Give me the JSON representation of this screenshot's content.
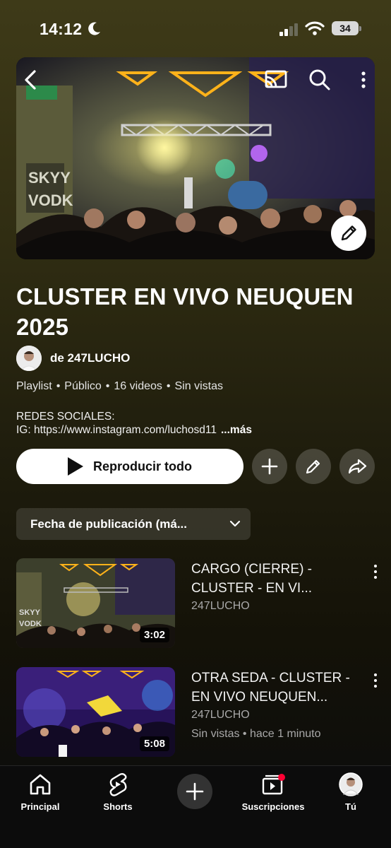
{
  "status_bar": {
    "time": "14:12",
    "battery": "34"
  },
  "hero": {
    "back_icon": "chevron-left-icon",
    "cast_icon": "cast-icon",
    "search_icon": "search-icon",
    "menu_icon": "more-vertical-icon",
    "edit_icon": "pencil-icon"
  },
  "playlist": {
    "title": "CLUSTER EN VIVO NEUQUEN 2025",
    "owner": "de 247LUCHO",
    "meta": {
      "type": "Playlist",
      "visibility": "Público",
      "count": "16 videos",
      "views": "Sin vistas"
    },
    "description_line1": "REDES SOCIALES:",
    "description_line2": "IG: https://www.instagram.com/luchosd11",
    "description_more": "...más"
  },
  "actions": {
    "play_all": "Reproducir todo",
    "add_icon": "plus-icon",
    "edit_icon": "pencil-icon",
    "share_icon": "share-icon"
  },
  "sort": {
    "label": "Fecha de publicación (má..."
  },
  "videos": [
    {
      "title": "CARGO (CIERRE) - CLUSTER - EN VI...",
      "channel": "247LUCHO",
      "duration": "3:02",
      "subtitle": ""
    },
    {
      "title": "OTRA SEDA - CLUSTER - EN VIVO NEUQUEN...",
      "channel": "247LUCHO",
      "duration": "5:08",
      "subtitle": "Sin vistas • hace 1 minuto"
    }
  ],
  "bottom_nav": {
    "home": "Principal",
    "shorts": "Shorts",
    "create_icon": "plus-icon",
    "subscriptions": "Suscripciones",
    "you": "Tú"
  },
  "colors": {
    "background": "#2f2c12",
    "accent_red": "#ff0033",
    "text": "#ffffff"
  }
}
